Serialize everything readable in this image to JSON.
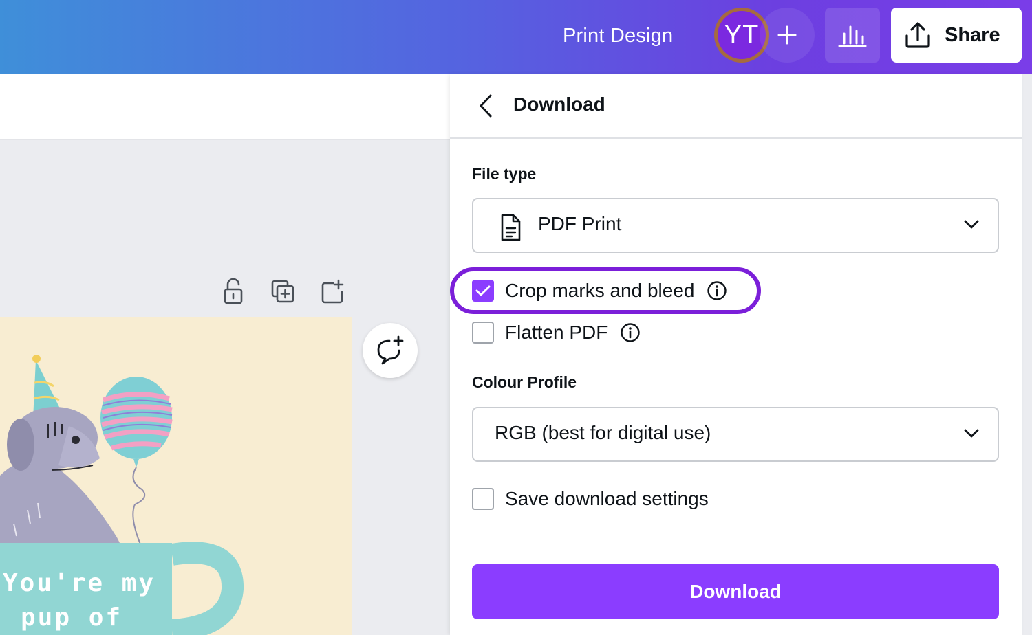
{
  "header": {
    "title": "Print Design",
    "avatar_initials": "YT",
    "share_label": "Share"
  },
  "card": {
    "text_line1": "You're my",
    "text_line2": "pup of"
  },
  "download_panel": {
    "title": "Download",
    "file_type_label": "File type",
    "file_type_value": "PDF Print",
    "crop_marks_label": "Crop marks and bleed",
    "crop_marks_checked": true,
    "flatten_pdf_label": "Flatten PDF",
    "flatten_pdf_checked": false,
    "colour_profile_label": "Colour Profile",
    "colour_profile_value": "RGB (best for digital use)",
    "save_settings_label": "Save download settings",
    "save_settings_checked": false,
    "download_button_label": "Download"
  },
  "colors": {
    "accent": "#8b3dff",
    "highlight": "#7b1fd9"
  }
}
